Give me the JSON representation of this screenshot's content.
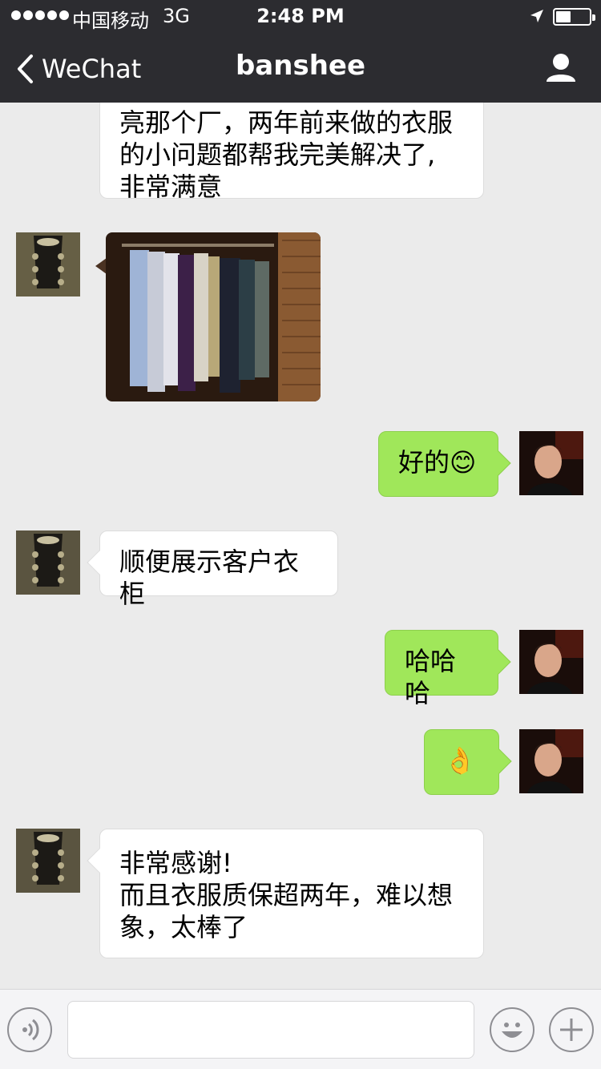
{
  "status_bar": {
    "carrier": "中国移动",
    "network": "3G",
    "time": "2:48 PM"
  },
  "nav": {
    "back_label": "WeChat",
    "title": "banshee"
  },
  "messages": [
    {
      "sender": "contact",
      "type": "text",
      "text": "亮那个厂，两年前来做的衣服\n的小问题都帮我完美解决了,\n非常满意"
    },
    {
      "sender": "contact",
      "type": "image",
      "description": ""
    },
    {
      "sender": "me",
      "type": "text",
      "text": "好的😊"
    },
    {
      "sender": "contact",
      "type": "text",
      "text": "顺便展示客户衣柜"
    },
    {
      "sender": "me",
      "type": "text",
      "text": "哈哈哈"
    },
    {
      "sender": "me",
      "type": "text",
      "text": "👌"
    },
    {
      "sender": "contact",
      "type": "text",
      "text": "非常感谢!\n而且衣服质保超两年，难以想\n象，太棒了"
    }
  ],
  "colors": {
    "nav_bg": "#2c2c30",
    "chat_bg": "#ebebeb",
    "my_bubble": "#a0e75a",
    "their_bubble": "#ffffff"
  },
  "input_bar": {
    "icons": [
      "voice-icon",
      "emoji-icon",
      "plus-icon"
    ]
  }
}
